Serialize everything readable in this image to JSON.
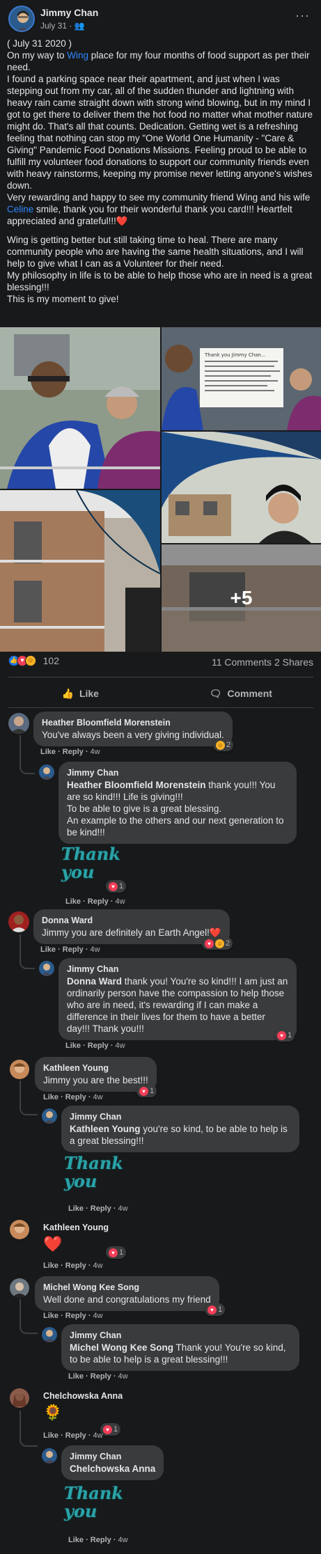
{
  "header": {
    "author": "Jimmy Chan",
    "date": "July 31 · ",
    "more": "···"
  },
  "post": {
    "p1a": "( July 31 2020 )",
    "p1b": "On my way to ",
    "p1c": "Wing",
    "p1d": " place for my four months of food support as per their need.",
    "p2": "I found a parking space near their apartment, and just when I was stepping out from my car, all of the sudden thunder and lightning with heavy rain came straight down with strong wind blowing, but in my mind I got to get there to deliver them the hot food no matter what mother nature might do. That's all that counts. Dedication. Getting wet is a refreshing feeling that nothing can stop my \"One World  One Humanity - \"Care & Giving\" Pandemic Food Donations Missions. Feeling proud to be able to fulfill my volunteer food donations to support our community friends even with heavy rainstorms, keeping my promise never letting anyone's wishes down.",
    "p3a": "Very rewarding and happy to see my community friend Wing and his wife ",
    "p3b": "Celine",
    "p3c": " smile, thank you for their wonderful thank you card!!! Heartfelt appreciated and grateful!!!❤️",
    "p4": "Wing is getting better but still taking time to heal. There are many community people who are having the same health situations, and I will help to give what I can as a Volunteer for their need.",
    "p5": "My philosophy in life is to be able to help those who are in need is a great blessing!!!",
    "p6": "This is my moment to give!"
  },
  "photos": {
    "more": "+5",
    "card": "Thank you Jimmy Chan for the 4 months, for your food donation to help all of your friend from our Senior Buildings. Thank you for our restaurant and your friends. Thank you for all your help"
  },
  "reactions": {
    "count": "102",
    "comments": "11 Comments",
    "shares": "2 Shares"
  },
  "actions": {
    "like": "Like",
    "comment": "Comment"
  },
  "comments": [
    {
      "name": "Heather Bloomfield Morenstein",
      "text": "You've always been a very giving individual.",
      "time": "4w",
      "react": "2"
    },
    {
      "name": "Jimmy Chan",
      "tag": "Heather Bloomfield Morenstein",
      "text": " thank you!!! You are so kind!!! Life is giving!!!",
      "t2": "To be able to give is a great blessing.",
      "t3": "An example to the others and our next generation to be kind!!!",
      "time": "4w",
      "react": "1",
      "sticker": "Thank you"
    },
    {
      "name": "Donna Ward",
      "text": "Jimmy you are definitely an Earth Angel!❤️",
      "time": "4w",
      "react": "2"
    },
    {
      "name": "Jimmy Chan",
      "tag": "Donna Ward",
      "text": " thank you! You're so kind!!! I am just an ordinarily person have the compassion to help those who are in need, it's rewarding if I can make a difference in their lives for them to have a better day!!! Thank you!!!",
      "time": "4w",
      "react": "1"
    },
    {
      "name": "Kathleen Young",
      "text": "Jimmy you are the best!!!",
      "time": "4w",
      "react": "1"
    },
    {
      "name": "Jimmy Chan",
      "tag": "Kathleen Young",
      "text": " you're so kind, to be able to help is a great blessing!!!",
      "time": "4w",
      "sticker": "Thank you"
    },
    {
      "name": "Kathleen Young",
      "emoji": "❤️",
      "time": "4w",
      "react": "1"
    },
    {
      "name": "Michel Wong Kee Song",
      "text": "Well done and congratulations my friend",
      "time": "4w",
      "react": "1"
    },
    {
      "name": "Jimmy Chan",
      "tag": "Michel Wong Kee Song",
      "text": " Thank you! You're so kind, to be able to help is a great blessing!!!",
      "time": "4w"
    },
    {
      "name": "Chelchowska Anna",
      "emoji": "🌻",
      "time": "4w",
      "react": "1"
    },
    {
      "name": "Jimmy Chan",
      "tag": "Chelchowska Anna",
      "time": "4w",
      "sticker": "Thank you"
    }
  ],
  "ui": {
    "like": "Like",
    "reply": "Reply",
    "sep": " · "
  }
}
